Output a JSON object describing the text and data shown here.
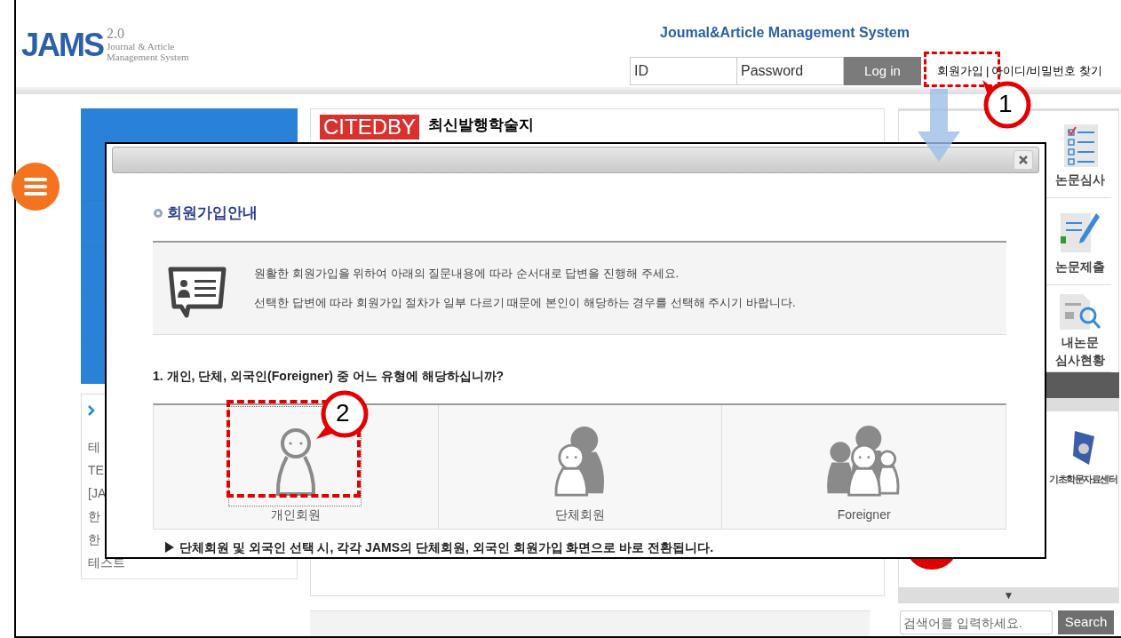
{
  "header": {
    "logo": {
      "name": "JAMS",
      "version": "2.0",
      "subtitle": [
        "Journal & Article",
        "Management System"
      ]
    },
    "system_title": "Joumal&Article Management System",
    "login": {
      "id_placeholder": "ID",
      "password_placeholder": "Password",
      "button": "Log in"
    },
    "links": [
      {
        "label": "회원가입"
      },
      {
        "label": "아이디/비밀번호 찾기"
      }
    ],
    "link_separator": "|"
  },
  "left_panel": {
    "items": [
      "테",
      "TE",
      "[JA",
      "한",
      "한",
      "테스트"
    ]
  },
  "center": {
    "badge": "CITEDBY",
    "title": "최신발행학술지"
  },
  "right_panel": {
    "menu": [
      {
        "kind": "review",
        "lines": [
          "논문심사"
        ]
      },
      {
        "kind": "submit",
        "lines": [
          "논문제출"
        ]
      },
      {
        "kind": "status",
        "lines": [
          "내논문",
          "심사현황"
        ]
      }
    ],
    "partner": "기초학문자료센터",
    "scroll_arrow": "▼",
    "search": {
      "placeholder": "검색어를 입력하세요.",
      "button": "Search"
    }
  },
  "modal": {
    "heading": "회원가입안내",
    "info": [
      "원활한 회원가입을 위하여 아래의 질문내용에 따라 순서대로 답변을 진행해 주세요.",
      "선택한 답변에 따라 회원가입 절차가 일부 다르기 때문에 본인이 해당하는 경우를 선택해 주시기 바랍니다."
    ],
    "question": "1. 개인, 단체, 외국인(Foreigner) 중 어느 유형에 해당하십니까?",
    "choices": [
      {
        "kind": "individual",
        "label": "개인회원",
        "selected": true
      },
      {
        "kind": "group",
        "label": "단체회원",
        "selected": false
      },
      {
        "kind": "foreign",
        "label": "Foreigner",
        "selected": false
      }
    ],
    "note": "▶ 단체회원 및 외국인 선택 시, 각각 JAMS의 단체회원, 외국인 회원가입 화면으로 바로 전환됩니다."
  },
  "annotations": [
    {
      "number": "1"
    },
    {
      "number": "2"
    }
  ]
}
